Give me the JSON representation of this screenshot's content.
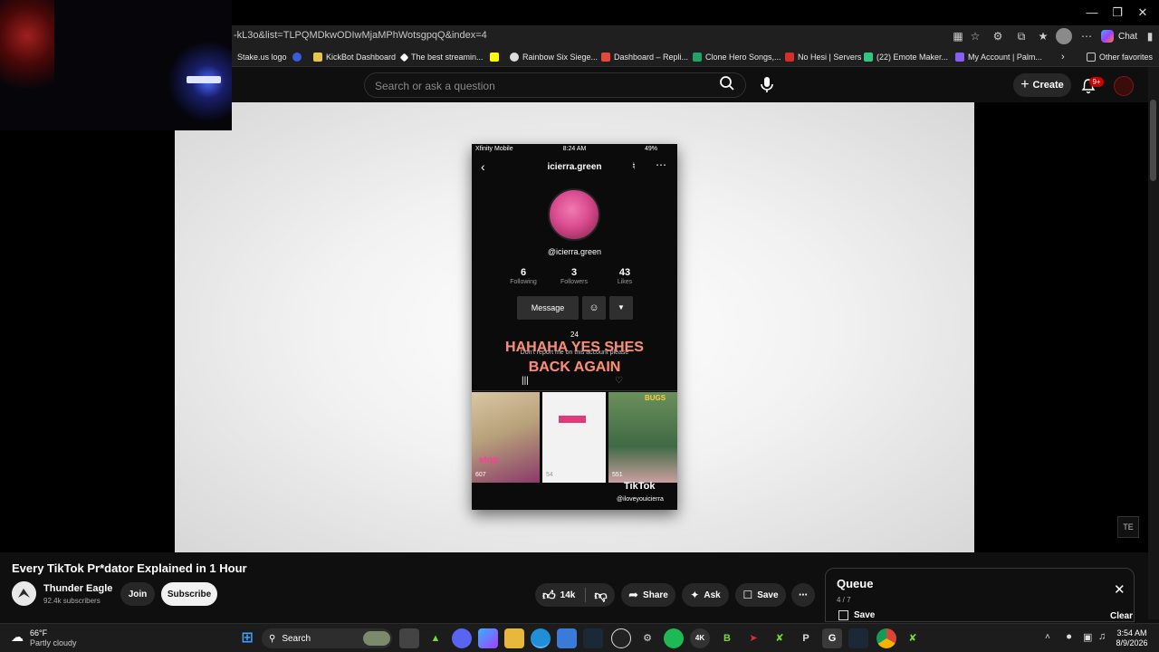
{
  "browser": {
    "url": "-kL3o&list=TLPQMDkwODIwMjaMPhWotsgpqQ&index=4",
    "copilot_label": "Chat",
    "bookmarks": [
      {
        "label": "Stake.us logo",
        "icon_color": "#1f1f1f"
      },
      {
        "label": "",
        "icon_color": "#3b5bdb"
      },
      {
        "label": "KickBot Dashboard",
        "icon_color": "#e8c547"
      },
      {
        "label": "The best streamin...",
        "icon_color": "#ffffff"
      },
      {
        "label": "",
        "icon_color": "#fffc00"
      },
      {
        "label": "Rainbow Six Siege...",
        "icon_color": "#dddddd"
      },
      {
        "label": "Dashboard – Repli...",
        "icon_color": "#e8483b"
      },
      {
        "label": "Clone Hero Songs,...",
        "icon_color": "#1fa463"
      },
      {
        "label": "No Hesi | Servers",
        "icon_color": "#d62c2c"
      },
      {
        "label": "(22) Emote Maker...",
        "icon_color": "#33c481"
      },
      {
        "label": "My Account | Palm...",
        "icon_color": "#8b5cf6"
      }
    ],
    "other_favorites": "Other favorites"
  },
  "youtube": {
    "search_placeholder": "Search or ask a question",
    "create_label": "Create",
    "notification_badge": "9+"
  },
  "video_frame": {
    "status_carrier": "Xfinity Mobile",
    "status_time": "8:24 AM",
    "status_battery": "49%",
    "username_header": "icierra.green",
    "handle": "@icierra.green",
    "stats": [
      {
        "num": "6",
        "label": "Following"
      },
      {
        "num": "3",
        "label": "Followers"
      },
      {
        "num": "43",
        "label": "Likes"
      }
    ],
    "message_button": "Message",
    "bio_count": "24",
    "bio_line": "Don't report me on this account please",
    "overlay_line1": "HAHAHA YES SHES",
    "overlay_line2": "BACK AGAIN",
    "thumb_counts": [
      "607",
      "54",
      "551"
    ],
    "thumb_text": "stop",
    "thumb_tag": "BUGS",
    "tiktok_logo": "TikTok",
    "tiktok_handle": "@iloveyouicierra",
    "corner_watermark": "TE"
  },
  "video_info": {
    "title": "Every TikTok Pr*dator Explained in 1 Hour",
    "channel_name": "Thunder Eagle",
    "subscribers": "92.4k subscribers",
    "join_label": "Join",
    "subscribe_label": "Subscribe",
    "likes": "14k",
    "share_label": "Share",
    "ask_label": "Ask",
    "save_label": "Save"
  },
  "queue": {
    "title": "Queue",
    "position": "4 / 7",
    "save_label": "Save",
    "clear_label": "Clear"
  },
  "taskbar": {
    "temperature": "66°F",
    "weather": "Partly cloudy",
    "search_label": "Search",
    "time": "3:54 AM",
    "date": "8/9/2026"
  }
}
